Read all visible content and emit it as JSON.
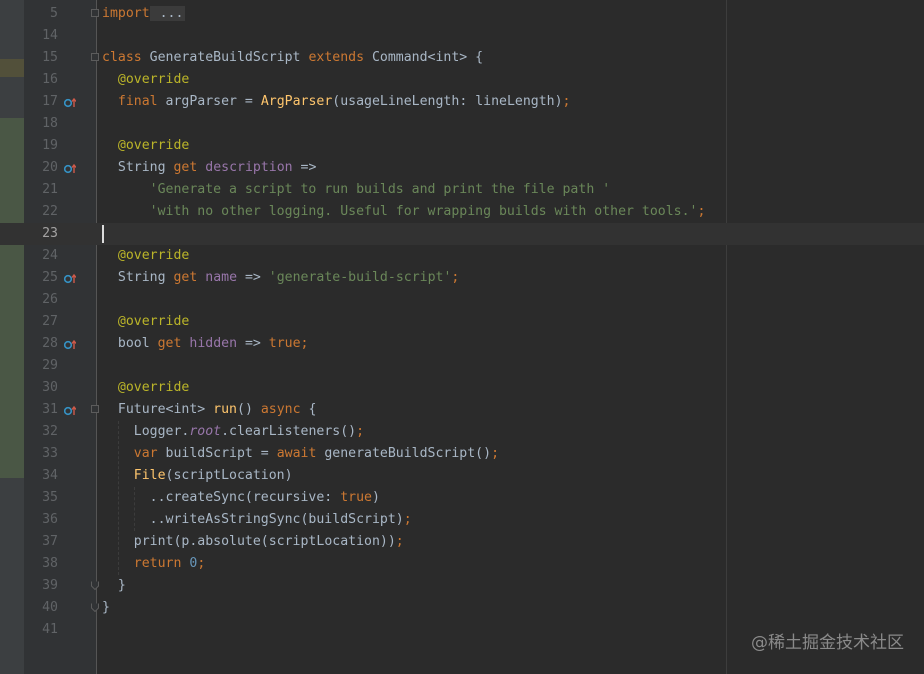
{
  "gutter": {
    "line_numbers": [
      "5",
      "14",
      "15",
      "16",
      "17",
      "18",
      "19",
      "20",
      "21",
      "22",
      "23",
      "24",
      "25",
      "26",
      "27",
      "28",
      "29",
      "30",
      "31",
      "32",
      "33",
      "34",
      "35",
      "36",
      "37",
      "38",
      "39",
      "40",
      "41"
    ]
  },
  "code": {
    "l5": {
      "kw": "import",
      "fold": " ..."
    },
    "l15": {
      "kw1": "class",
      "name": " GenerateBuildScript ",
      "kw2": "extends",
      "rest": " Command<int> {"
    },
    "l16": {
      "ann": "@override"
    },
    "l17": {
      "kw": "final",
      "var": " argParser = ",
      "fn": "ArgParser",
      "args": "(usageLineLength: lineLength)",
      "semi": ";"
    },
    "l19": {
      "ann": "@override"
    },
    "l20": {
      "type": "String ",
      "kw": "get",
      "sp": " ",
      "prop": "description",
      "rest": " =>"
    },
    "l21": {
      "str": "'Generate a script to run builds and print the file path '"
    },
    "l22": {
      "str": "'with no other logging. Useful for wrapping builds with other tools.'",
      "semi": ";"
    },
    "l24": {
      "ann": "@override"
    },
    "l25": {
      "type": "String ",
      "kw": "get",
      "sp": " ",
      "prop": "name",
      "arrow": " => ",
      "str": "'generate-build-script'",
      "semi": ";"
    },
    "l27": {
      "ann": "@override"
    },
    "l28": {
      "type": "bool ",
      "kw": "get",
      "sp": " ",
      "prop": "hidden",
      "arrow": " => ",
      "val": "true",
      "semi": ";"
    },
    "l30": {
      "ann": "@override"
    },
    "l31": {
      "type": "Future<int> ",
      "fn": "run",
      "paren": "() ",
      "kw": "async",
      "brace": " {"
    },
    "l32": {
      "a": "Logger.",
      "b": "root",
      "c": ".clearListeners()",
      "semi": ";"
    },
    "l33": {
      "kw": "var",
      "mid": " buildScript = ",
      "kw2": "await",
      "rest": " generateBuildScript()",
      "semi": ";"
    },
    "l34": {
      "fn": "File",
      "rest": "(scriptLocation)"
    },
    "l35": {
      "a": "..createSync(recursive: ",
      "val": "true",
      "b": ")"
    },
    "l36": {
      "a": "..writeAsStringSync(buildScript)",
      "semi": ";"
    },
    "l37": {
      "a": "print(p.absolute(scriptLocation))",
      "semi": ";"
    },
    "l38": {
      "kw": "return",
      "sp": " ",
      "num": "0",
      "semi": ";"
    },
    "l39": {
      "a": "}"
    },
    "l40": {
      "a": "}"
    }
  },
  "watermark": "@稀土掘金技术社区",
  "colors": {
    "background": "#2b2b2b",
    "gutter": "#313335",
    "keyword": "#cc7832",
    "annotation": "#bbb529",
    "function": "#ffc66d",
    "string": "#6a8759",
    "property": "#9876aa",
    "text": "#a9b7c6",
    "override_icon": "#3592c4"
  }
}
